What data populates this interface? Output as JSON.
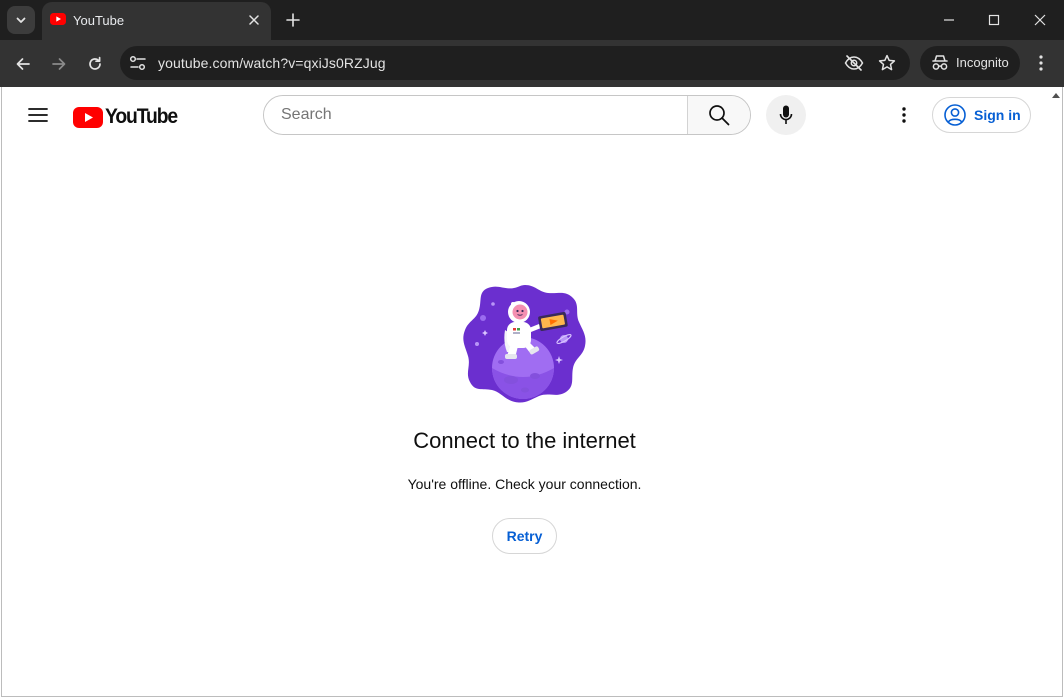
{
  "browser": {
    "tab": {
      "title": "YouTube",
      "favicon": "youtube-favicon"
    },
    "url": "youtube.com/watch?v=qxiJs0RZJug",
    "incognito_label": "Incognito",
    "colors": {
      "frame": "#1f1f1f",
      "toolbar": "#333333",
      "text": "#e3e3e3"
    }
  },
  "youtube": {
    "logo_text": "YouTube",
    "search_placeholder": "Search",
    "signin_label": "Sign in",
    "colors": {
      "brand_red": "#ff0000",
      "link_blue": "#065fd4"
    }
  },
  "offline": {
    "title": "Connect to the internet",
    "message": "You're offline. Check your connection.",
    "retry_label": "Retry",
    "illustration": "astronaut-on-planet"
  }
}
